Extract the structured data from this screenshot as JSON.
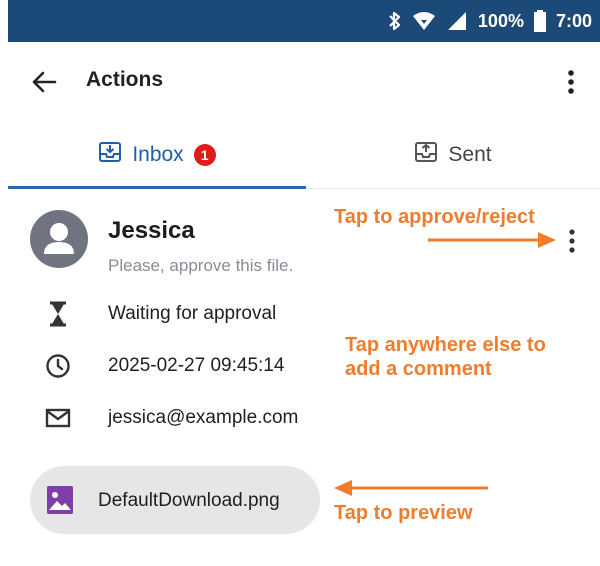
{
  "status_bar": {
    "battery": "100%",
    "time": "7:00"
  },
  "app_bar": {
    "title": "Actions"
  },
  "tabs": [
    {
      "label": "Inbox",
      "badge": "1",
      "selected": true
    },
    {
      "label": "Sent",
      "selected": false
    }
  ],
  "item": {
    "sender": "Jessica",
    "message": "Please, approve this file.",
    "status": "Waiting for approval",
    "timestamp": "2025-02-27 09:45:14",
    "email": "jessica@example.com",
    "attachment": "DefaultDownload.png"
  },
  "annotations": {
    "approve": "Tap to approve/reject",
    "comment_line1": "Tap anywhere else to",
    "comment_line2": "add a comment",
    "preview": "Tap to preview"
  },
  "colors": {
    "status_bar": "#1c4a78",
    "accent": "#2a6bb3",
    "badge": "#e01b1b",
    "annotation": "#f07d2d"
  }
}
